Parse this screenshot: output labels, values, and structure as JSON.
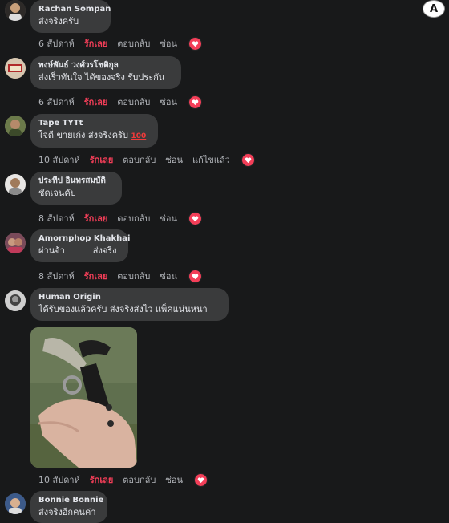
{
  "actions": {
    "like_label": "รักเลย",
    "reply_label": "ตอบกลับ",
    "hide_label": "ซ่อน",
    "edit_label": "แก้ไขแล้ว"
  },
  "translate_button_label": "A",
  "comments": [
    {
      "author": "Rachan Sompan",
      "text": "ส่งจริงครับ",
      "time": "6 สัปดาห์"
    },
    {
      "author": "พงษ์พันธ์ วงศ์วรโชติกุล",
      "text": "ส่งเร็วทันใจ ได้ของจริง รับประกัน",
      "time": "6 สัปดาห์"
    },
    {
      "author": "Tape TYTt",
      "text": "ใจดี ขายเก่ง ส่งจริงครับ",
      "emoji": "100",
      "time": "10 สัปดาห์"
    },
    {
      "author": "ประทีป อินทรสมบัติ",
      "text": "ชัดเจนคับ",
      "time": "8 สัปดาห์"
    },
    {
      "author": "Amornphop Khakhai",
      "text": "ผ่านจ้า          ส่งจริง",
      "time": "8 สัปดาห์"
    },
    {
      "author": "Human Origin",
      "text": "ได้รับของแล้วครับ ส่งจริงส่งไว แพ็คแน่นหนา",
      "time": "10 สัปดาห์"
    },
    {
      "author": "Bonnie Bonnie",
      "text": "ส่งจริงอีกคนค่า"
    }
  ],
  "colors": {
    "background": "#18191a",
    "bubble": "#3a3b3c",
    "like": "#f33e58",
    "meta": "#b0b3b8"
  }
}
